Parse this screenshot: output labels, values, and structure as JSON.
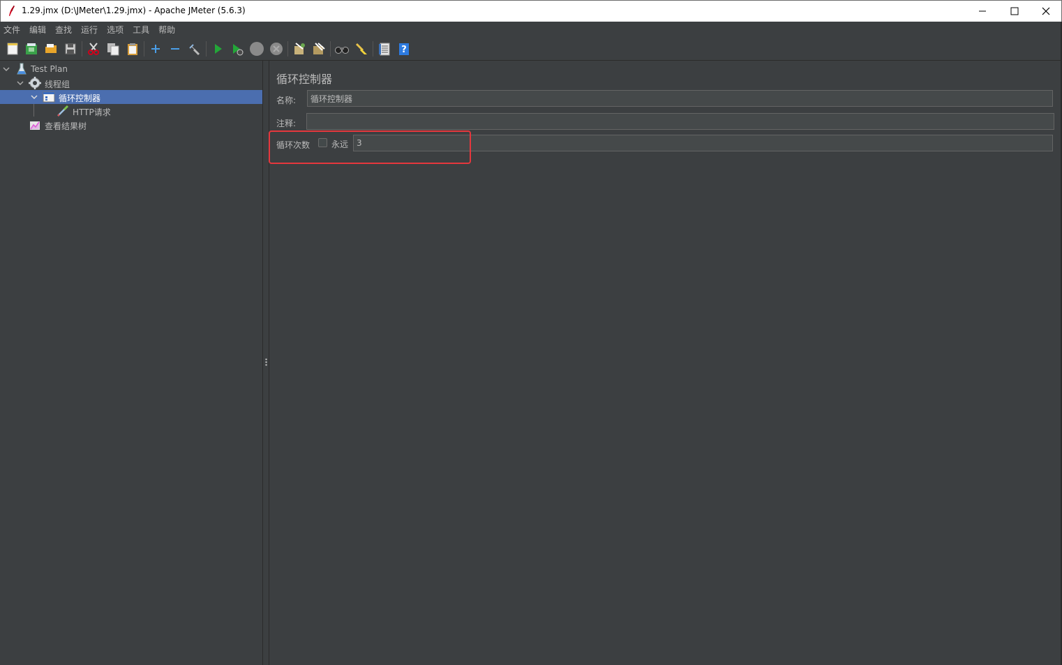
{
  "window": {
    "title": "1.29.jmx (D:\\JMeter\\1.29.jmx) - Apache JMeter (5.6.3)"
  },
  "menu": [
    "文件",
    "编辑",
    "查找",
    "运行",
    "选项",
    "工具",
    "帮助"
  ],
  "toolbar": {
    "icons": [
      "new-icon",
      "templates-icon",
      "open-icon",
      "save-icon",
      "cut-icon",
      "copy-icon",
      "paste-icon",
      "expand-icon",
      "collapse-icon",
      "toggle-icon",
      "start-icon",
      "start-no-pause-icon",
      "stop-icon",
      "shutdown-icon",
      "clear-icon",
      "clear-all-icon",
      "search-icon",
      "reset-search-icon",
      "function-helper-icon",
      "help-icon"
    ]
  },
  "tree": {
    "items": [
      {
        "label": "Test Plan",
        "level": 0,
        "expanded": true
      },
      {
        "label": "线程组",
        "level": 1,
        "expanded": true
      },
      {
        "label": "循环控制器",
        "level": 2,
        "expanded": true,
        "selected": true
      },
      {
        "label": "HTTP请求",
        "level": 3
      },
      {
        "label": "查看结果树",
        "level": 1
      }
    ]
  },
  "panel": {
    "title": "循环控制器",
    "name_label": "名称:",
    "name_value": "循环控制器",
    "comment_label": "注释:",
    "comment_value": "",
    "loop_label": "循环次数",
    "forever_label": "永远",
    "forever_checked": false,
    "loop_value": "3"
  },
  "colors": {
    "background": "#3c3f41",
    "selection": "#4b6eaf",
    "highlight": "#e5373d"
  }
}
